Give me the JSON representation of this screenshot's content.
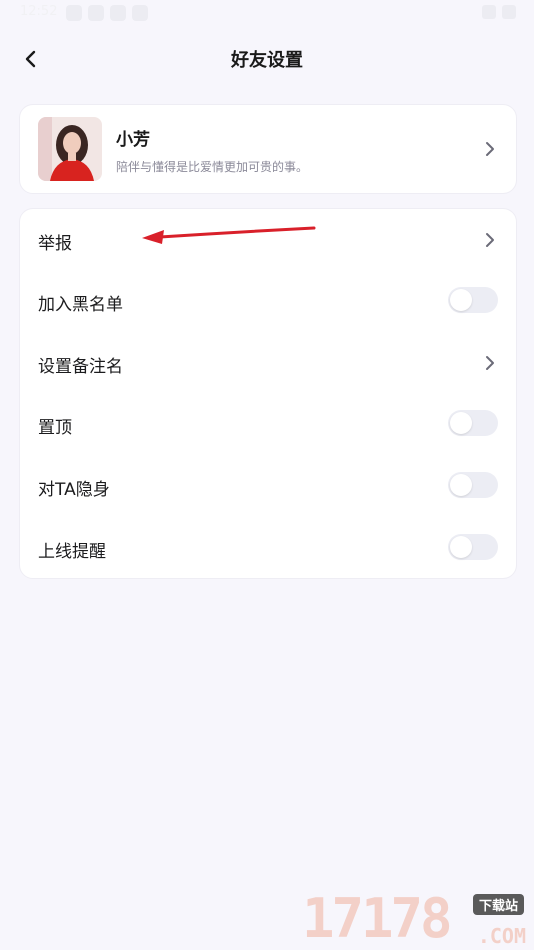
{
  "status_bar": {
    "time": "12:52"
  },
  "header": {
    "title": "好友设置",
    "back_icon": "chevron-left-icon"
  },
  "profile": {
    "name": "小芳",
    "signature": "陪伴与懂得是比爱情更加可贵的事。",
    "chevron_icon": "chevron-right-icon"
  },
  "settings": [
    {
      "label": "举报",
      "control": "chevron"
    },
    {
      "label": "加入黑名单",
      "control": "toggle",
      "on": false
    },
    {
      "label": "设置备注名",
      "control": "chevron"
    },
    {
      "label": "置顶",
      "control": "toggle",
      "on": false
    },
    {
      "label": "对TA隐身",
      "control": "toggle",
      "on": false
    },
    {
      "label": "上线提醒",
      "control": "toggle",
      "on": false
    }
  ],
  "annotation": {
    "color": "#d9202a",
    "icon": "red-arrow-annotation"
  },
  "watermark": {
    "number": "17178",
    "badge": "下载站",
    "domain": ".COM"
  },
  "colors": {
    "background": "#f7f6fc",
    "card": "#ffffff",
    "toggle_off": "#ecedf4",
    "secondary_text": "#8b8a99"
  }
}
